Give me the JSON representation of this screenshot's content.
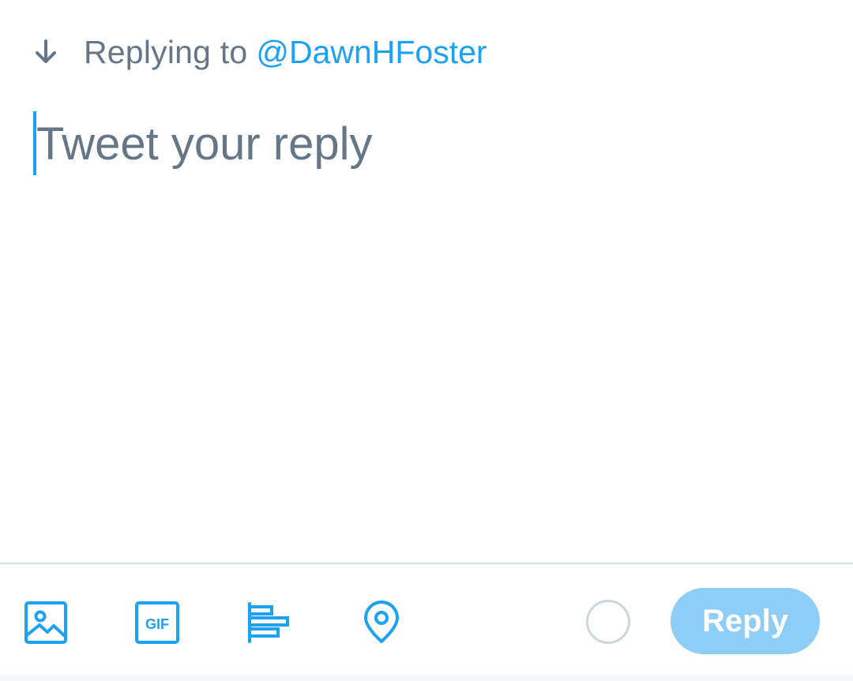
{
  "header": {
    "replying_label": "Replying to",
    "handle": "@DawnHFoster",
    "icon": "arrow-down-icon"
  },
  "compose": {
    "placeholder": "Tweet your reply",
    "value": ""
  },
  "toolbar": {
    "media_icon": "image-icon",
    "gif_icon": "gif-icon",
    "gif_label": "GIF",
    "poll_icon": "poll-icon",
    "location_icon": "location-pin-icon",
    "counter_icon": "character-counter-icon",
    "reply_label": "Reply"
  },
  "colors": {
    "accent": "#1da1f2",
    "secondary_text": "#657786",
    "reply_button_disabled": "#8ecdf8",
    "divider": "#cfe1ea",
    "counter_ring": "#ccd6dd"
  }
}
